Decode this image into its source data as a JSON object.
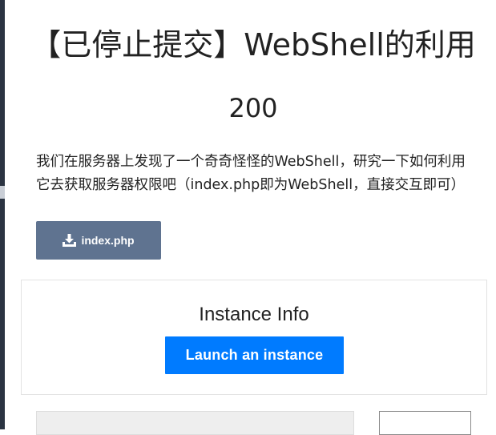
{
  "challenge": {
    "title": "【已停止提交】WebShell的利用",
    "points": "200",
    "description": "我们在服务器上发现了一个奇奇怪怪的WebShell，研究一下如何利用它去获取服务器权限吧（index.php即为WebShell，直接交互即可）"
  },
  "download": {
    "label": "index.php",
    "icon": "download-icon"
  },
  "instance": {
    "heading": "Instance Info",
    "launch_label": "Launch an instance"
  },
  "colors": {
    "download_button": "#5f7390",
    "launch_button": "#007bff",
    "text": "#222222"
  }
}
